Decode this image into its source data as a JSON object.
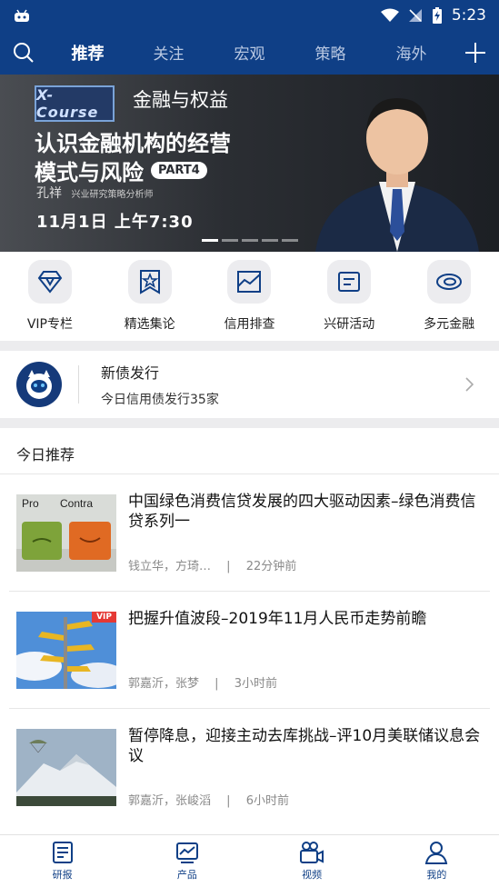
{
  "status_bar": {
    "time": "5:23"
  },
  "nav": {
    "tabs": [
      {
        "label": "推荐",
        "active": true
      },
      {
        "label": "关注",
        "active": false
      },
      {
        "label": "宏观",
        "active": false
      },
      {
        "label": "策略",
        "active": false
      },
      {
        "label": "海外",
        "active": false
      }
    ],
    "search_icon": "search-icon",
    "add_icon": "plus-icon"
  },
  "banner": {
    "logo_text": "X-Course",
    "series": "金融与权益",
    "title_line1": "认识金融机构的经营",
    "title_line2": "模式与风险",
    "part": "PART4",
    "speaker": "孔祥",
    "speaker_role": "兴业研究策略分析师",
    "date": "11月1日 上午7:30",
    "active_slide": 1,
    "slide_count": 5
  },
  "quick_links": [
    {
      "label": "VIP专栏",
      "icon": "diamond-icon"
    },
    {
      "label": "精选集论",
      "icon": "star-bookmark-icon"
    },
    {
      "label": "信用排查",
      "icon": "chart-icon"
    },
    {
      "label": "兴研活动",
      "icon": "document-icon"
    },
    {
      "label": "多元金融",
      "icon": "swirl-icon"
    }
  ],
  "bond_issue": {
    "title": "新债发行",
    "subtitle": "今日信用债发行35家"
  },
  "today": {
    "heading": "今日推荐",
    "articles": [
      {
        "title": "中国绿色消费信贷发展的四大驱动因素–绿色消费信贷系列一",
        "authors": "钱立华，方琦…",
        "time": "22分钟前",
        "vip": false
      },
      {
        "title": "把握升值波段–2019年11月人民币走势前瞻",
        "authors": "郭嘉沂，张梦",
        "time": "3小时前",
        "vip": true,
        "badge": "VIP"
      },
      {
        "title": "暂停降息，迎接主动去库挑战–评10月美联储议息会议",
        "authors": "郭嘉沂，张峻滔",
        "time": "6小时前",
        "vip": false
      }
    ]
  },
  "bottom_nav": [
    {
      "label": "研报",
      "icon": "report-icon"
    },
    {
      "label": "产品",
      "icon": "product-chart-icon"
    },
    {
      "label": "视频",
      "icon": "video-icon"
    },
    {
      "label": "我的",
      "icon": "user-icon"
    }
  ],
  "colors": {
    "brand": "#0f3f86",
    "accent_red": "#e53935"
  }
}
